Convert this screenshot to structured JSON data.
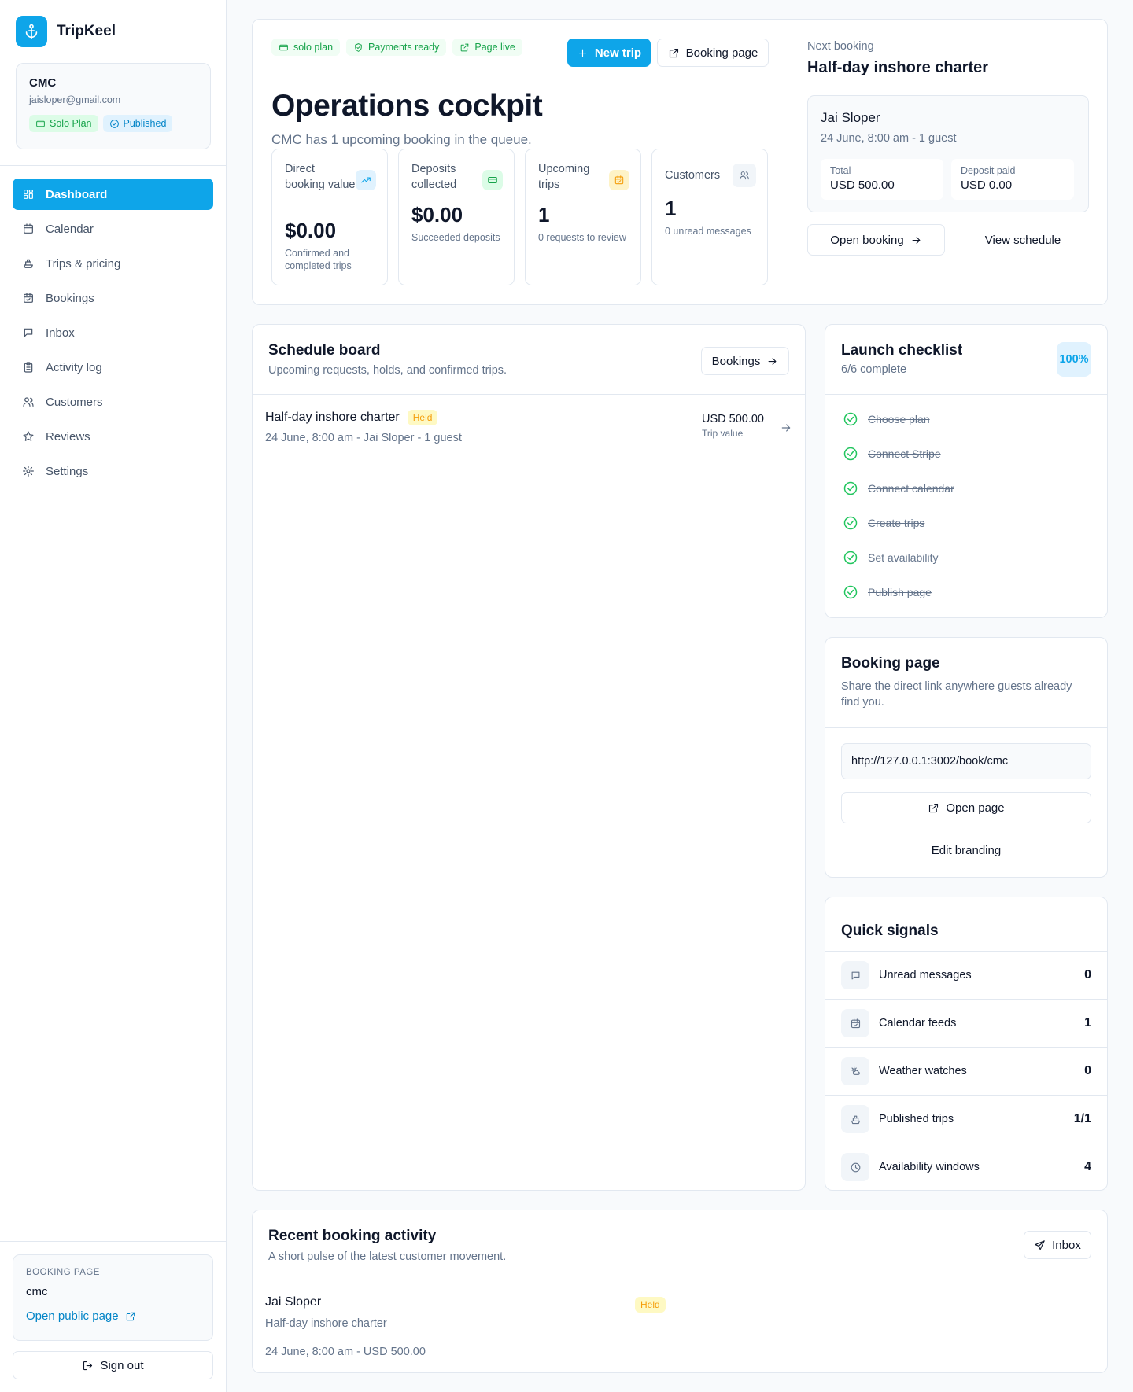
{
  "brand": {
    "name": "TripKeel",
    "accent": "#0ea5e9"
  },
  "account": {
    "name": "CMC",
    "email": "jaisloper@gmail.com",
    "plan_badge": "Solo Plan",
    "status_badge": "Published"
  },
  "nav": [
    {
      "label": "Dashboard",
      "icon": "dashboard-icon",
      "active": true
    },
    {
      "label": "Calendar",
      "icon": "calendar-icon"
    },
    {
      "label": "Trips & pricing",
      "icon": "boat-icon"
    },
    {
      "label": "Bookings",
      "icon": "calendar-check-icon"
    },
    {
      "label": "Inbox",
      "icon": "message-icon"
    },
    {
      "label": "Activity log",
      "icon": "clipboard-icon"
    },
    {
      "label": "Customers",
      "icon": "users-icon"
    },
    {
      "label": "Reviews",
      "icon": "star-icon"
    },
    {
      "label": "Settings",
      "icon": "gear-icon"
    }
  ],
  "sidebar_booking": {
    "title": "BOOKING PAGE",
    "slug": "cmc",
    "link": "Open public page"
  },
  "signout": "Sign out",
  "hero": {
    "tags": [
      "solo plan",
      "Payments ready",
      "Page live"
    ],
    "new_trip": "New trip",
    "booking_page": "Booking page",
    "title": "Operations cockpit",
    "subtitle": "CMC has 1 upcoming booking in the queue.",
    "stats": [
      {
        "label": "Direct booking value",
        "value": "$0.00",
        "note": "Confirmed and completed trips",
        "icon": "trending-up-icon"
      },
      {
        "label": "Deposits collected",
        "value": "$0.00",
        "note": "Succeeded deposits",
        "icon": "credit-card-icon"
      },
      {
        "label": "Upcoming trips",
        "value": "1",
        "note": "0 requests to review",
        "icon": "calendar-check-icon"
      },
      {
        "label": "Customers",
        "value": "1",
        "note": "0 unread messages",
        "icon": "users-icon"
      }
    ]
  },
  "next_booking": {
    "label": "Next booking",
    "title": "Half-day inshore charter",
    "customer": "Jai Sloper",
    "meta": "24 June, 8:00 am - 1 guest",
    "total_label": "Total",
    "total_value": "USD 500.00",
    "deposit_label": "Deposit paid",
    "deposit_value": "USD 0.00",
    "open": "Open booking",
    "view": "View schedule"
  },
  "schedule": {
    "title": "Schedule board",
    "subtitle": "Upcoming requests, holds, and confirmed trips.",
    "button": "Bookings",
    "rows": [
      {
        "title": "Half-day inshore charter",
        "status": "Held",
        "meta": "24 June, 8:00 am - Jai Sloper - 1 guest",
        "amount": "USD 500.00",
        "amount_label": "Trip value"
      }
    ]
  },
  "launch": {
    "title": "Launch checklist",
    "subtitle": "6/6 complete",
    "percent": "100%",
    "items": [
      "Choose plan",
      "Connect Stripe",
      "Connect calendar",
      "Create trips",
      "Set availability",
      "Publish page"
    ]
  },
  "booking_page": {
    "title": "Booking page",
    "subtitle": "Share the direct link anywhere guests already find you.",
    "url": "http://127.0.0.1:3002/book/cmc",
    "open": "Open page",
    "edit": "Edit branding"
  },
  "signals": {
    "title": "Quick signals",
    "items": [
      {
        "label": "Unread messages",
        "value": "0",
        "icon": "message-icon"
      },
      {
        "label": "Calendar feeds",
        "value": "1",
        "icon": "calendar-check-icon"
      },
      {
        "label": "Weather watches",
        "value": "0",
        "icon": "weather-icon"
      },
      {
        "label": "Published trips",
        "value": "1/1",
        "icon": "boat-icon"
      },
      {
        "label": "Availability windows",
        "value": "4",
        "icon": "clock-icon"
      }
    ]
  },
  "recent": {
    "title": "Recent booking activity",
    "subtitle": "A short pulse of the latest customer movement.",
    "button": "Inbox",
    "items": [
      {
        "name": "Jai Sloper",
        "trip": "Half-day inshore charter",
        "status": "Held",
        "meta": "24 June, 8:00 am - USD 500.00"
      }
    ]
  }
}
